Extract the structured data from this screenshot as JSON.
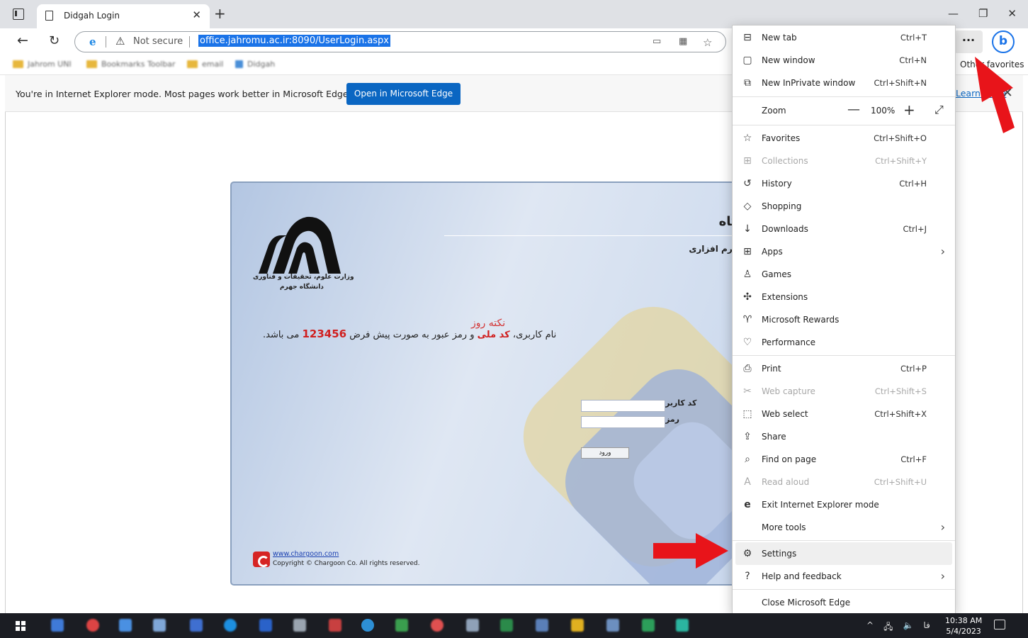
{
  "tab": {
    "title": "Didgah Login",
    "close": "✕",
    "new_tab": "+"
  },
  "window_controls": {
    "minimize": "—",
    "restore": "❐",
    "close": "✕"
  },
  "address": {
    "not_secure": "Not secure",
    "url": "office.jahromu.ac.ir:8090/UserLogin.aspx"
  },
  "favorites_bar": {
    "items": [
      "Jahrom UNI",
      "Bookmarks Toolbar",
      "email",
      "Didgah"
    ],
    "other": "Other favorites"
  },
  "ie_bar": {
    "message": "You're in Internet Explorer mode. Most pages work better in Microsoft Edge.",
    "button": "Open in Microsoft Edge",
    "learn_more": "Learn more"
  },
  "login": {
    "university_name": "دانشگاه جهرم",
    "system_name": "سامانه نرم افزاری دیدگاه",
    "logo_line1": "وزارت علوم، تحقیقات و فناوری",
    "logo_line2": "دانشگاه جهرم",
    "tip_title": "نکته روز",
    "tip_part1": "نام کاربری، ",
    "tip_code": "کد ملی",
    "tip_part2": " و رمز عبور به صورت پیش فرض ",
    "tip_number": "123456",
    "tip_part3": " می باشد.",
    "user_label": "کد کاربر",
    "pass_label": "رمز",
    "login_button": "ورود",
    "vendor_link": "www.chargoon.com",
    "copyright": "Copyright © Chargoon Co. All rights reserved."
  },
  "menu": {
    "new_tab": {
      "label": "New tab",
      "shortcut": "Ctrl+T"
    },
    "new_window": {
      "label": "New window",
      "shortcut": "Ctrl+N"
    },
    "new_inprivate": {
      "label": "New InPrivate window",
      "shortcut": "Ctrl+Shift+N"
    },
    "zoom": {
      "label": "Zoom",
      "value": "100%"
    },
    "favorites": {
      "label": "Favorites",
      "shortcut": "Ctrl+Shift+O"
    },
    "collections": {
      "label": "Collections",
      "shortcut": "Ctrl+Shift+Y"
    },
    "history": {
      "label": "History",
      "shortcut": "Ctrl+H"
    },
    "shopping": {
      "label": "Shopping"
    },
    "downloads": {
      "label": "Downloads",
      "shortcut": "Ctrl+J"
    },
    "apps": {
      "label": "Apps"
    },
    "games": {
      "label": "Games"
    },
    "extensions": {
      "label": "Extensions"
    },
    "rewards": {
      "label": "Microsoft Rewards"
    },
    "performance": {
      "label": "Performance"
    },
    "print": {
      "label": "Print",
      "shortcut": "Ctrl+P"
    },
    "web_capture": {
      "label": "Web capture",
      "shortcut": "Ctrl+Shift+S"
    },
    "web_select": {
      "label": "Web select",
      "shortcut": "Ctrl+Shift+X"
    },
    "share": {
      "label": "Share"
    },
    "find": {
      "label": "Find on page",
      "shortcut": "Ctrl+F"
    },
    "read_aloud": {
      "label": "Read aloud",
      "shortcut": "Ctrl+Shift+U"
    },
    "exit_ie": {
      "label": "Exit Internet Explorer mode"
    },
    "more_tools": {
      "label": "More tools"
    },
    "settings": {
      "label": "Settings"
    },
    "help": {
      "label": "Help and feedback"
    },
    "close_edge": {
      "label": "Close Microsoft Edge"
    }
  },
  "taskbar": {
    "language": "فا",
    "time": "10:38 AM",
    "date": "5/4/2023"
  },
  "colors": {
    "accent": "#0a66c2",
    "annotation_arrow": "#e8141a",
    "tip_red": "#d01f1f"
  }
}
